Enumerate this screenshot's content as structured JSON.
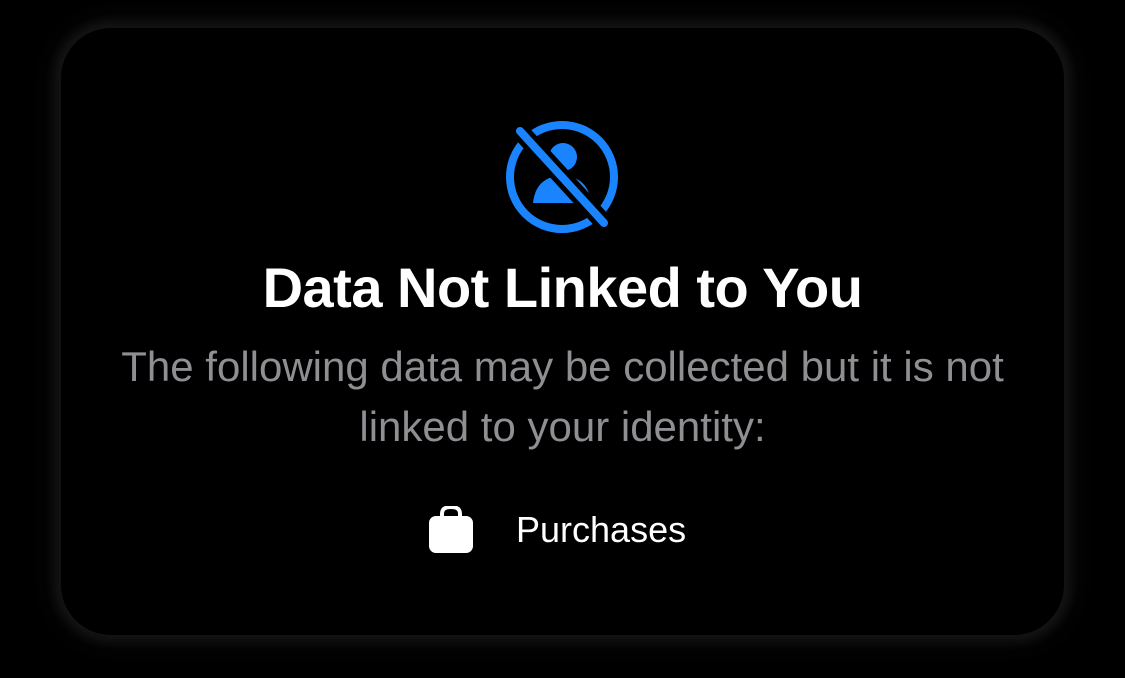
{
  "card": {
    "icon": "person-slash-circle-icon",
    "title": "Data Not Linked to You",
    "description": "The following data may be collected but it is not linked to your identity:",
    "data_types": [
      {
        "icon": "shopping-bag-icon",
        "label": "Purchases"
      }
    ]
  },
  "colors": {
    "background": "#000000",
    "accent": "#1a84ff",
    "title": "#ffffff",
    "secondary_text": "#8e8e93"
  }
}
